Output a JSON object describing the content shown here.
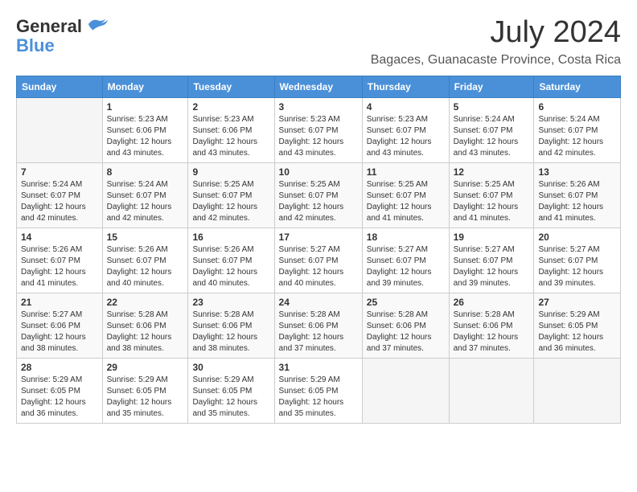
{
  "logo": {
    "general": "General",
    "blue": "Blue"
  },
  "title": {
    "month": "July 2024",
    "location": "Bagaces, Guanacaste Province, Costa Rica"
  },
  "calendar": {
    "headers": [
      "Sunday",
      "Monday",
      "Tuesday",
      "Wednesday",
      "Thursday",
      "Friday",
      "Saturday"
    ],
    "weeks": [
      [
        {
          "day": "",
          "sunrise": "",
          "sunset": "",
          "daylight": ""
        },
        {
          "day": "1",
          "sunrise": "Sunrise: 5:23 AM",
          "sunset": "Sunset: 6:06 PM",
          "daylight": "Daylight: 12 hours and 43 minutes."
        },
        {
          "day": "2",
          "sunrise": "Sunrise: 5:23 AM",
          "sunset": "Sunset: 6:06 PM",
          "daylight": "Daylight: 12 hours and 43 minutes."
        },
        {
          "day": "3",
          "sunrise": "Sunrise: 5:23 AM",
          "sunset": "Sunset: 6:07 PM",
          "daylight": "Daylight: 12 hours and 43 minutes."
        },
        {
          "day": "4",
          "sunrise": "Sunrise: 5:23 AM",
          "sunset": "Sunset: 6:07 PM",
          "daylight": "Daylight: 12 hours and 43 minutes."
        },
        {
          "day": "5",
          "sunrise": "Sunrise: 5:24 AM",
          "sunset": "Sunset: 6:07 PM",
          "daylight": "Daylight: 12 hours and 43 minutes."
        },
        {
          "day": "6",
          "sunrise": "Sunrise: 5:24 AM",
          "sunset": "Sunset: 6:07 PM",
          "daylight": "Daylight: 12 hours and 42 minutes."
        }
      ],
      [
        {
          "day": "7",
          "sunrise": "Sunrise: 5:24 AM",
          "sunset": "Sunset: 6:07 PM",
          "daylight": "Daylight: 12 hours and 42 minutes."
        },
        {
          "day": "8",
          "sunrise": "Sunrise: 5:24 AM",
          "sunset": "Sunset: 6:07 PM",
          "daylight": "Daylight: 12 hours and 42 minutes."
        },
        {
          "day": "9",
          "sunrise": "Sunrise: 5:25 AM",
          "sunset": "Sunset: 6:07 PM",
          "daylight": "Daylight: 12 hours and 42 minutes."
        },
        {
          "day": "10",
          "sunrise": "Sunrise: 5:25 AM",
          "sunset": "Sunset: 6:07 PM",
          "daylight": "Daylight: 12 hours and 42 minutes."
        },
        {
          "day": "11",
          "sunrise": "Sunrise: 5:25 AM",
          "sunset": "Sunset: 6:07 PM",
          "daylight": "Daylight: 12 hours and 41 minutes."
        },
        {
          "day": "12",
          "sunrise": "Sunrise: 5:25 AM",
          "sunset": "Sunset: 6:07 PM",
          "daylight": "Daylight: 12 hours and 41 minutes."
        },
        {
          "day": "13",
          "sunrise": "Sunrise: 5:26 AM",
          "sunset": "Sunset: 6:07 PM",
          "daylight": "Daylight: 12 hours and 41 minutes."
        }
      ],
      [
        {
          "day": "14",
          "sunrise": "Sunrise: 5:26 AM",
          "sunset": "Sunset: 6:07 PM",
          "daylight": "Daylight: 12 hours and 41 minutes."
        },
        {
          "day": "15",
          "sunrise": "Sunrise: 5:26 AM",
          "sunset": "Sunset: 6:07 PM",
          "daylight": "Daylight: 12 hours and 40 minutes."
        },
        {
          "day": "16",
          "sunrise": "Sunrise: 5:26 AM",
          "sunset": "Sunset: 6:07 PM",
          "daylight": "Daylight: 12 hours and 40 minutes."
        },
        {
          "day": "17",
          "sunrise": "Sunrise: 5:27 AM",
          "sunset": "Sunset: 6:07 PM",
          "daylight": "Daylight: 12 hours and 40 minutes."
        },
        {
          "day": "18",
          "sunrise": "Sunrise: 5:27 AM",
          "sunset": "Sunset: 6:07 PM",
          "daylight": "Daylight: 12 hours and 39 minutes."
        },
        {
          "day": "19",
          "sunrise": "Sunrise: 5:27 AM",
          "sunset": "Sunset: 6:07 PM",
          "daylight": "Daylight: 12 hours and 39 minutes."
        },
        {
          "day": "20",
          "sunrise": "Sunrise: 5:27 AM",
          "sunset": "Sunset: 6:07 PM",
          "daylight": "Daylight: 12 hours and 39 minutes."
        }
      ],
      [
        {
          "day": "21",
          "sunrise": "Sunrise: 5:27 AM",
          "sunset": "Sunset: 6:06 PM",
          "daylight": "Daylight: 12 hours and 38 minutes."
        },
        {
          "day": "22",
          "sunrise": "Sunrise: 5:28 AM",
          "sunset": "Sunset: 6:06 PM",
          "daylight": "Daylight: 12 hours and 38 minutes."
        },
        {
          "day": "23",
          "sunrise": "Sunrise: 5:28 AM",
          "sunset": "Sunset: 6:06 PM",
          "daylight": "Daylight: 12 hours and 38 minutes."
        },
        {
          "day": "24",
          "sunrise": "Sunrise: 5:28 AM",
          "sunset": "Sunset: 6:06 PM",
          "daylight": "Daylight: 12 hours and 37 minutes."
        },
        {
          "day": "25",
          "sunrise": "Sunrise: 5:28 AM",
          "sunset": "Sunset: 6:06 PM",
          "daylight": "Daylight: 12 hours and 37 minutes."
        },
        {
          "day": "26",
          "sunrise": "Sunrise: 5:28 AM",
          "sunset": "Sunset: 6:06 PM",
          "daylight": "Daylight: 12 hours and 37 minutes."
        },
        {
          "day": "27",
          "sunrise": "Sunrise: 5:29 AM",
          "sunset": "Sunset: 6:05 PM",
          "daylight": "Daylight: 12 hours and 36 minutes."
        }
      ],
      [
        {
          "day": "28",
          "sunrise": "Sunrise: 5:29 AM",
          "sunset": "Sunset: 6:05 PM",
          "daylight": "Daylight: 12 hours and 36 minutes."
        },
        {
          "day": "29",
          "sunrise": "Sunrise: 5:29 AM",
          "sunset": "Sunset: 6:05 PM",
          "daylight": "Daylight: 12 hours and 35 minutes."
        },
        {
          "day": "30",
          "sunrise": "Sunrise: 5:29 AM",
          "sunset": "Sunset: 6:05 PM",
          "daylight": "Daylight: 12 hours and 35 minutes."
        },
        {
          "day": "31",
          "sunrise": "Sunrise: 5:29 AM",
          "sunset": "Sunset: 6:05 PM",
          "daylight": "Daylight: 12 hours and 35 minutes."
        },
        {
          "day": "",
          "sunrise": "",
          "sunset": "",
          "daylight": ""
        },
        {
          "day": "",
          "sunrise": "",
          "sunset": "",
          "daylight": ""
        },
        {
          "day": "",
          "sunrise": "",
          "sunset": "",
          "daylight": ""
        }
      ]
    ]
  }
}
